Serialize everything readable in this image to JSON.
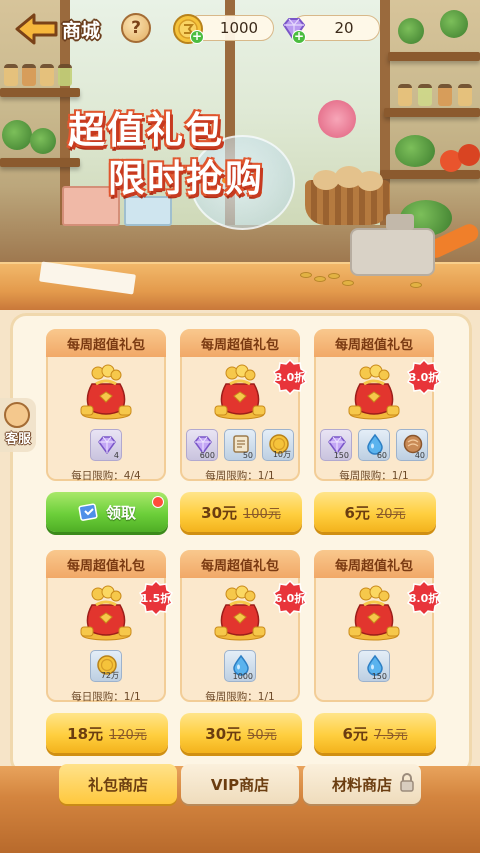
{
  "header": {
    "title": "商城",
    "help_label": "?",
    "gold_amount": "1000",
    "gem_amount": "20",
    "plus": "+"
  },
  "hero": {
    "line1": "超值礼包",
    "line2": "限时抢购"
  },
  "service": {
    "label": "客服"
  },
  "cards": [
    {
      "title": "每周超值礼包",
      "discount": "",
      "items": [
        {
          "icon": "gem-icon",
          "qty": "4"
        }
      ],
      "limit": "每日限购：4/4",
      "button": {
        "type": "claim",
        "label": "领取",
        "price": "",
        "original": ""
      }
    },
    {
      "title": "每周超值礼包",
      "discount": "3.0折",
      "items": [
        {
          "icon": "gem-icon",
          "qty": "600"
        },
        {
          "icon": "scroll-icon",
          "qty": "50"
        },
        {
          "icon": "gold-coin-icon",
          "qty": "10万"
        }
      ],
      "limit": "每周限购：1/1",
      "button": {
        "type": "buy",
        "label": "",
        "price": "30元",
        "original": "100元"
      }
    },
    {
      "title": "每周超值礼包",
      "discount": "3.0折",
      "items": [
        {
          "icon": "gem-icon",
          "qty": "150"
        },
        {
          "icon": "water-drop-icon",
          "qty": "60"
        },
        {
          "icon": "bread-icon",
          "qty": "40"
        }
      ],
      "limit": "每周限购：1/1",
      "button": {
        "type": "buy",
        "label": "",
        "price": "6元",
        "original": "20元"
      }
    },
    {
      "title": "每周超值礼包",
      "discount": "1.5折",
      "items": [
        {
          "icon": "gold-coin-icon",
          "qty": "72万"
        }
      ],
      "limit": "每日限购：1/1",
      "button": {
        "type": "buy",
        "label": "",
        "price": "18元",
        "original": "120元"
      }
    },
    {
      "title": "每周超值礼包",
      "discount": "6.0折",
      "items": [
        {
          "icon": "water-drop-icon",
          "qty": "1000"
        }
      ],
      "limit": "每周限购：1/1",
      "button": {
        "type": "buy",
        "label": "",
        "price": "30元",
        "original": "50元"
      }
    },
    {
      "title": "每周超值礼包",
      "discount": "8.0折",
      "items": [
        {
          "icon": "water-drop-icon",
          "qty": "150"
        }
      ],
      "limit": "",
      "button": {
        "type": "buy",
        "label": "",
        "price": "6元",
        "original": "7.5元"
      }
    }
  ],
  "tabs": [
    {
      "label": "礼包商店",
      "active": true
    },
    {
      "label": "VIP商店",
      "active": false
    },
    {
      "label": "材料商店",
      "active": false,
      "locked": true
    }
  ]
}
